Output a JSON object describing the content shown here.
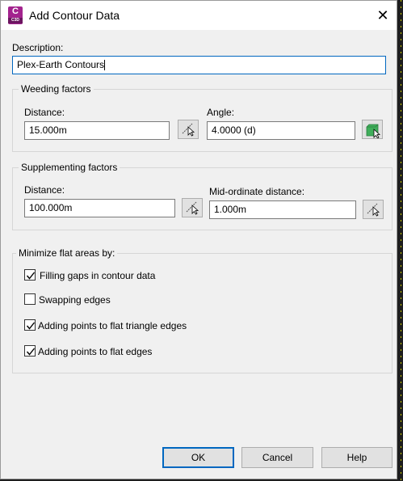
{
  "window": {
    "title": "Add Contour Data",
    "icon_letter": "C",
    "icon_sub": "C3D",
    "close_glyph": "✕"
  },
  "description": {
    "label": "Description:",
    "value": "Plex-Earth Contours"
  },
  "weeding": {
    "title": "Weeding factors",
    "distance_label": "Distance:",
    "distance_value": "15.000m",
    "angle_label": "Angle:",
    "angle_value": "4.0000 (d)"
  },
  "supplementing": {
    "title": "Supplementing factors",
    "distance_label": "Distance:",
    "distance_value": "100.000m",
    "mid_label": "Mid-ordinate distance:",
    "mid_value": "1.000m"
  },
  "minimize": {
    "title": "Minimize flat areas by:",
    "options": [
      {
        "label": "Filling gaps in contour data",
        "checked": true
      },
      {
        "label": "Swapping edges",
        "checked": false
      },
      {
        "label": "Adding points to flat triangle edges",
        "checked": true
      },
      {
        "label": "Adding points to flat edges",
        "checked": true
      }
    ]
  },
  "buttons": {
    "ok": "OK",
    "cancel": "Cancel",
    "help": "Help"
  },
  "colors": {
    "accent": "#0067c0",
    "app_icon": "#a3238e",
    "angle_pick": "#3fae5a"
  }
}
